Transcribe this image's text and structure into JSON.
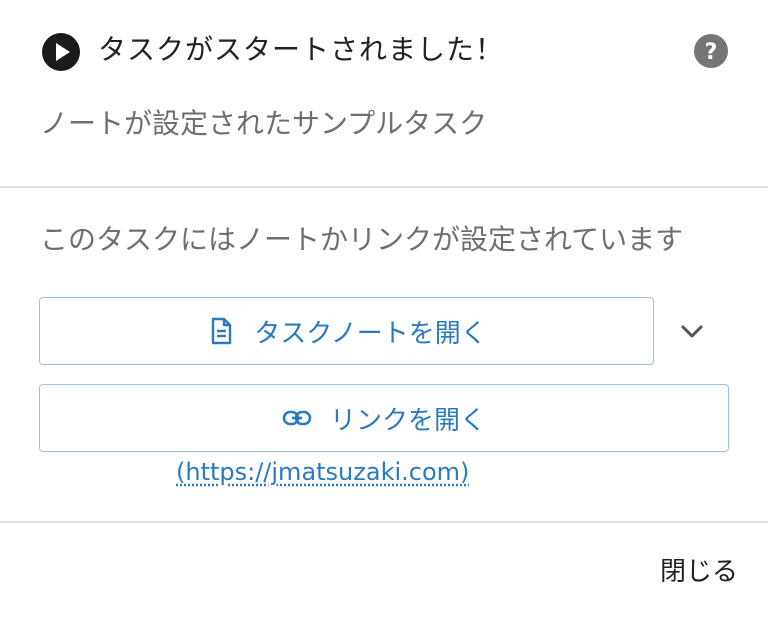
{
  "header": {
    "title": "タスクがスタートされました！",
    "play_icon": "play-circle-icon",
    "help_icon": "help-circle-icon"
  },
  "task": {
    "name": "ノートが設定されたサンプルタスク"
  },
  "message": "このタスクにはノートかリンクが設定されています",
  "actions": {
    "open_note_label": "タスクノートを開く",
    "open_note_icon": "document-icon",
    "expand_icon": "chevron-down-icon",
    "open_link_label": "リンクを開く",
    "open_link_icon": "link-icon",
    "link_url": "(https://jmatsuzaki.com)"
  },
  "footer": {
    "close_label": "閉じる"
  },
  "colors": {
    "accent": "#2a7ac0",
    "button_border": "#9cc4e4",
    "title_text": "#212121",
    "secondary_text": "#6f6f6f",
    "icon_dark": "#1a1a1a",
    "help_icon": "#757575",
    "divider": "#e0e0e0"
  }
}
